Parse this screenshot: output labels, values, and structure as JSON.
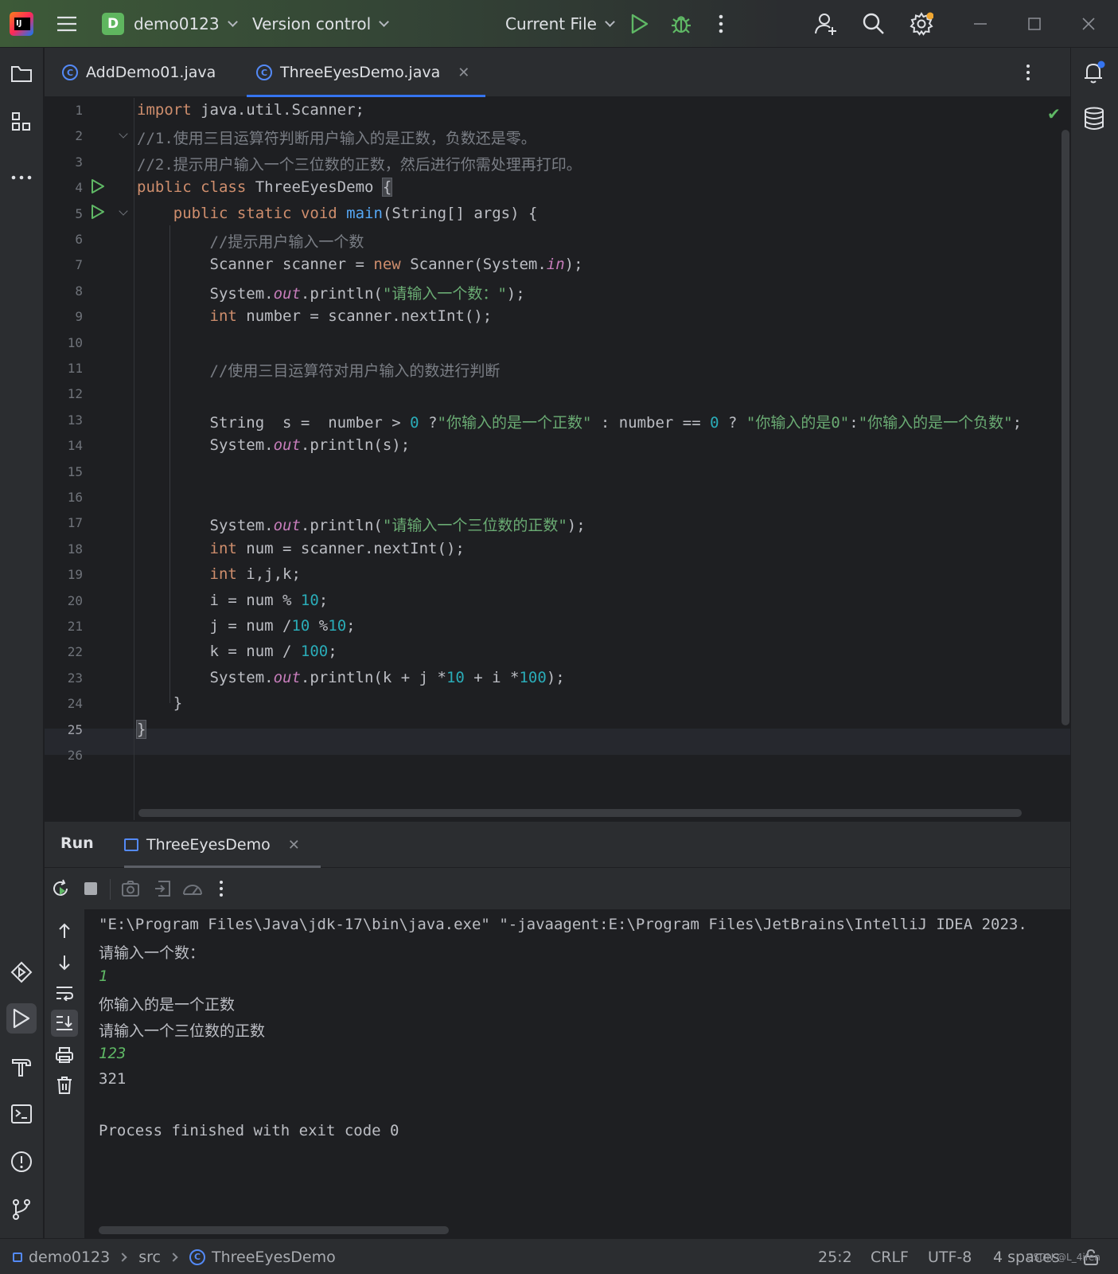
{
  "titlebar": {
    "project_badge": "D",
    "project_name": "demo0123",
    "vcs": "Version control",
    "run_config": "Current File"
  },
  "tabs": [
    {
      "label": "AddDemo01.java",
      "icon": "class-icon"
    },
    {
      "label": "ThreeEyesDemo.java",
      "icon": "class-icon",
      "active": true
    }
  ],
  "editor": {
    "line_numbers": [
      "1",
      "2",
      "3",
      "4",
      "5",
      "6",
      "7",
      "8",
      "9",
      "10",
      "11",
      "12",
      "13",
      "14",
      "15",
      "16",
      "17",
      "18",
      "19",
      "20",
      "21",
      "22",
      "23",
      "24",
      "25",
      "26"
    ],
    "current_line": "25",
    "lines": [
      "import java.util.Scanner;",
      "//1.使用三目运算符判断用户输入的是正数，负数还是零。",
      "//2.提示用户输入一个三位数的正数，然后进行你需处理再打印。",
      "public class ThreeEyesDemo {",
      "    public static void main(String[] args) {",
      "        //提示用户输入一个数",
      "        Scanner scanner = new Scanner(System.in);",
      "        System.out.println(\"请输入一个数：\");",
      "        int number = scanner.nextInt();",
      "",
      "        //使用三目运算符对用户输入的数进行判断",
      "",
      "        String  s =  number > 0 ?\"你输入的是一个正数\" : number == 0 ? \"你输入的是0\":\"你输入的是一个负数\";",
      "        System.out.println(s);",
      "",
      "",
      "        System.out.println(\"请输入一个三位数的正数\");",
      "        int num = scanner.nextInt();",
      "        int i,j,k;",
      "        i = num % 10;",
      "        j = num /10 %10;",
      "        k = num / 100;",
      "        System.out.println(k + j *10 + i *100);",
      "    }",
      "}",
      ""
    ]
  },
  "run_panel": {
    "title": "Run",
    "tab_label": "ThreeEyesDemo",
    "output": [
      {
        "text": "\"E:\\Program Files\\Java\\jdk-17\\bin\\java.exe\" \"-javaagent:E:\\Program Files\\JetBrains\\IntelliJ IDEA 2023.",
        "kind": "normal"
      },
      {
        "text": "请输入一个数：",
        "kind": "normal"
      },
      {
        "text": "1",
        "kind": "input"
      },
      {
        "text": "你输入的是一个正数",
        "kind": "normal"
      },
      {
        "text": "请输入一个三位数的正数",
        "kind": "normal"
      },
      {
        "text": "123",
        "kind": "input"
      },
      {
        "text": "321",
        "kind": "normal"
      },
      {
        "text": "",
        "kind": "normal"
      },
      {
        "text": "Process finished with exit code 0",
        "kind": "normal"
      }
    ]
  },
  "statusbar": {
    "breadcrumbs": [
      "demo0123",
      "src",
      "ThreeEyesDemo"
    ],
    "caret": "25:2",
    "line_sep": "CRLF",
    "encoding": "UTF-8",
    "indent": "4 spaces",
    "watermark": "CSDN @L_4ifen"
  },
  "colors": {
    "keyword": "#cf8e6d",
    "comment": "#7a7e85",
    "string": "#6aab73",
    "number": "#2aacb8",
    "static_field": "#c77dbb",
    "method_decl": "#56a8f5",
    "accent": "#3574f0"
  }
}
